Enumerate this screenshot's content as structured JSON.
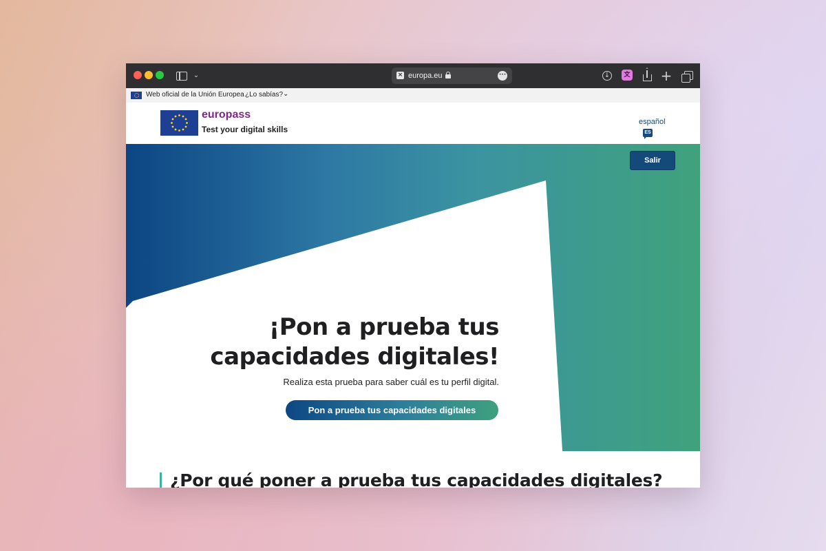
{
  "browser": {
    "url": "europa.eu",
    "icons": [
      "sidebar-icon",
      "chevron-down-icon",
      "lock-icon",
      "more-icon",
      "download-icon",
      "extension-icon",
      "share-icon",
      "plus-icon",
      "tabs-icon"
    ]
  },
  "eu_banner": {
    "official_text": "Web oficial de la Unión Europea",
    "know_more": "¿Lo sabías?"
  },
  "header": {
    "brand": "europass",
    "subtitle": "Test your digital skills",
    "language": "español",
    "language_code": "ES"
  },
  "hero": {
    "logout_label": "Salir",
    "title_line1": "¡Pon a prueba tus",
    "title_line2": "capacidades digitales!",
    "subtitle": "Realiza esta prueba para saber cuál es tu perfil digital.",
    "cta_label": "Pon a prueba tus capacidades digitales"
  },
  "section": {
    "title": "¿Por qué poner a prueba tus capacidades digitales?"
  },
  "colors": {
    "brand_purple": "#7a2a83",
    "eu_blue": "#1d3f94",
    "hero_start": "#0c4583",
    "hero_end": "#3fa27c",
    "accent_teal": "#3fb1a0"
  }
}
